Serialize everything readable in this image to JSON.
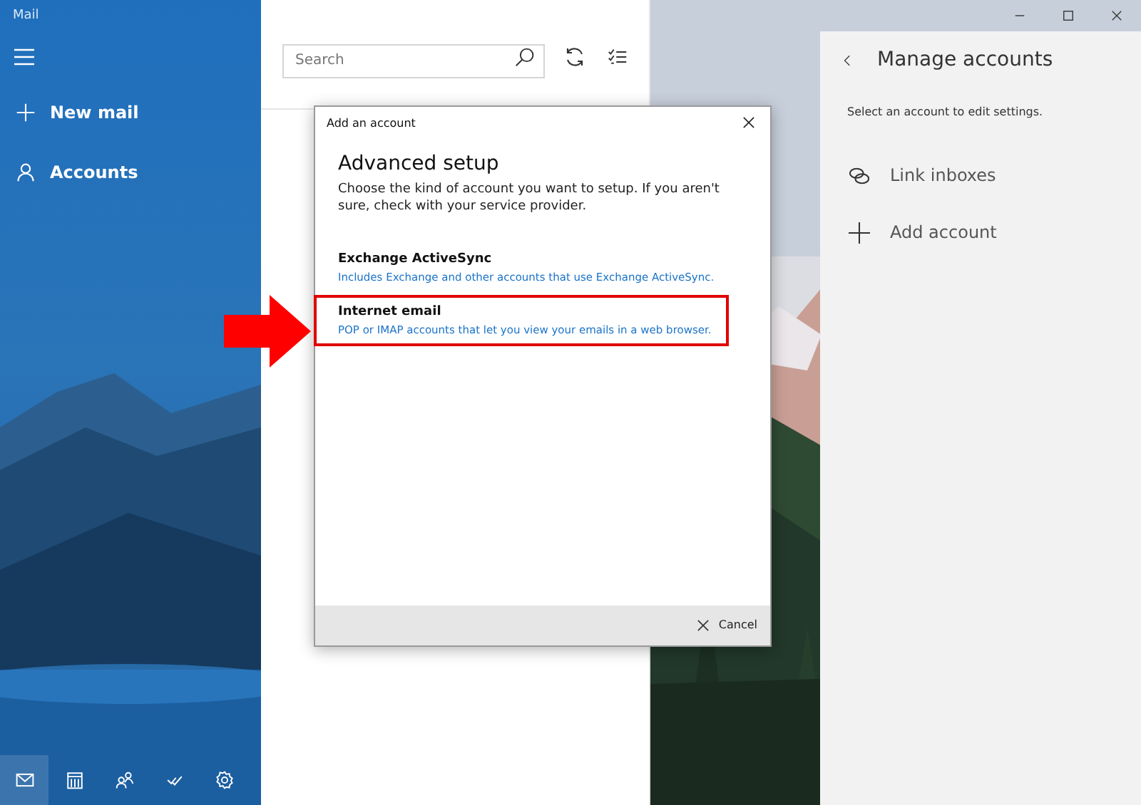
{
  "window": {
    "title": "Mail"
  },
  "sidebar": {
    "items": [
      {
        "label": "New mail",
        "kind": "new"
      },
      {
        "label": "Accounts",
        "kind": "accounts"
      }
    ],
    "bottom_nav": [
      {
        "kind": "mail",
        "selected": true
      },
      {
        "kind": "calendar",
        "selected": false
      },
      {
        "kind": "people",
        "selected": false
      },
      {
        "kind": "todo",
        "selected": false
      },
      {
        "kind": "settings",
        "selected": false
      }
    ]
  },
  "search": {
    "placeholder": "Search"
  },
  "dialog": {
    "title": "Add an account",
    "heading": "Advanced setup",
    "description": "Choose the kind of account you want to setup. If you aren't sure, check with your service provider.",
    "options": [
      {
        "title": "Exchange ActiveSync",
        "description": "Includes Exchange and other accounts that use Exchange ActiveSync.",
        "highlighted": false
      },
      {
        "title": "Internet email",
        "description": "POP or IMAP accounts that let you view your emails in a web browser.",
        "highlighted": true
      }
    ],
    "cancel": "Cancel"
  },
  "manage_accounts": {
    "title": "Manage accounts",
    "subtitle": "Select an account to edit settings.",
    "items": [
      {
        "label": "Link inboxes",
        "kind": "link"
      },
      {
        "label": "Add account",
        "kind": "add"
      }
    ]
  }
}
